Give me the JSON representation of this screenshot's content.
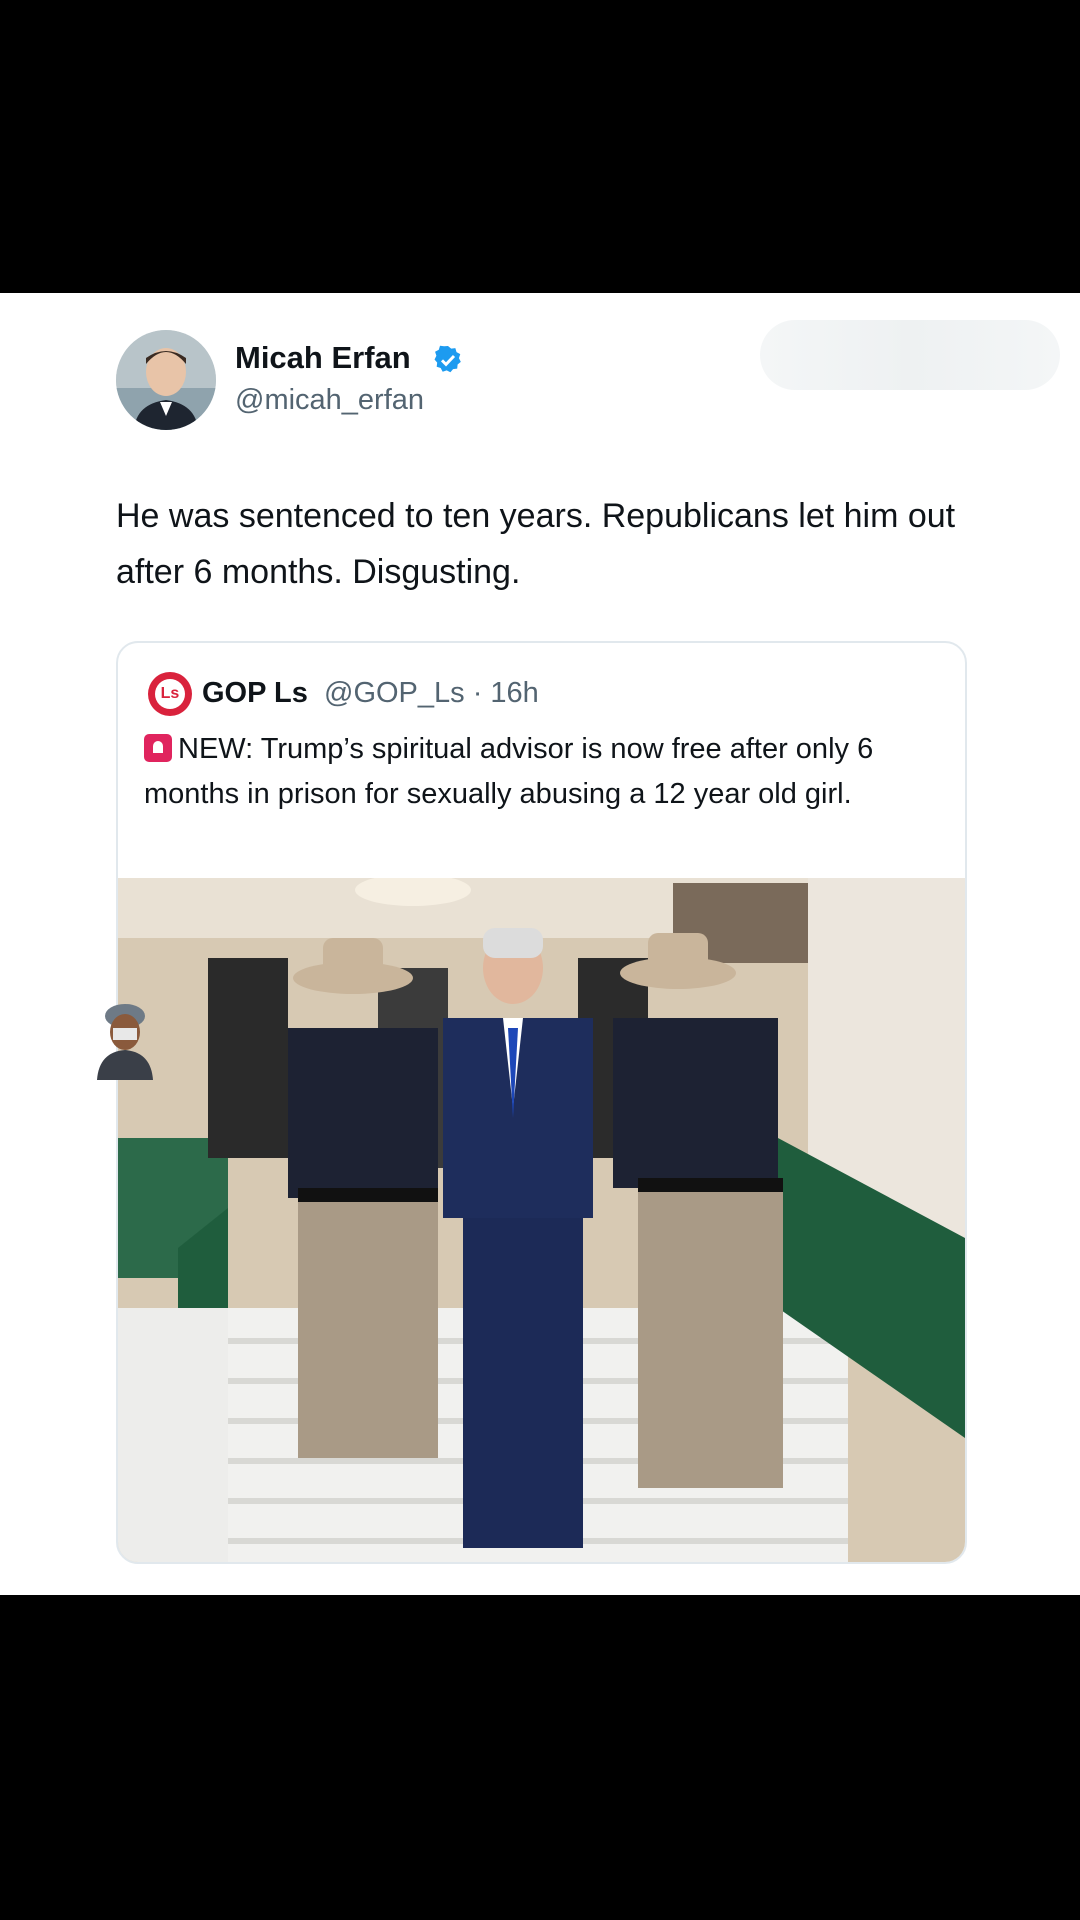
{
  "tweet": {
    "author_name": "Micah Erfan",
    "author_handle": "@micah_erfan",
    "text": "He was sentenced to ten years. Republicans let him out after 6 months. Disgusting."
  },
  "quoted": {
    "logo_text": "Ls",
    "author_name": "GOP Ls",
    "meta": "@GOP_Ls · 16h",
    "text": "NEW: Trump’s spiritual advisor is now free after only 6 months in prison for sexually abusing a 12 year old girl."
  },
  "colors": {
    "verified": "#1d9bf0",
    "background": "#000000",
    "card": "#ffffff",
    "handle": "#536471"
  },
  "icons": [
    "verified-badge-icon",
    "siren-icon"
  ]
}
